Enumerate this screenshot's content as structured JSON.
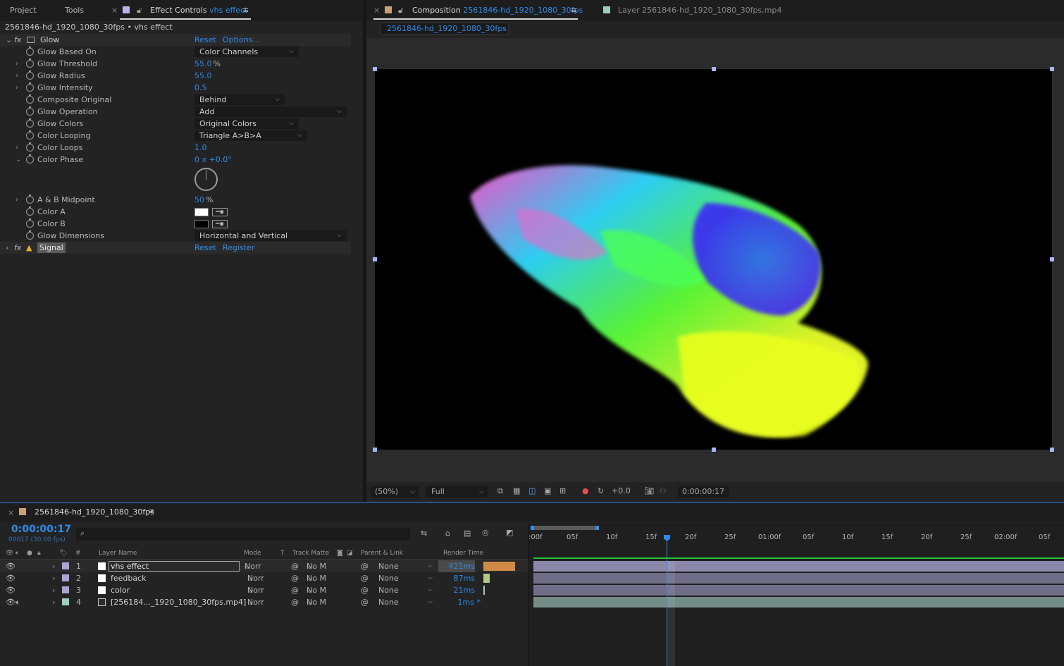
{
  "left_panel": {
    "tabs": [
      "Project",
      "Tools"
    ],
    "effect_controls_tab": {
      "label": "Effect Controls",
      "layer": "vhs effect"
    },
    "breadcrumb": "2561846-hd_1920_1080_30fps • vhs effect",
    "glow": {
      "name": "Glow",
      "reset": "Reset",
      "options": "Options...",
      "params": [
        {
          "name": "Glow Based On",
          "type": "dropdown",
          "value": "Color Channels"
        },
        {
          "name": "Glow Threshold",
          "type": "value",
          "value": "55.0",
          "unit": "%"
        },
        {
          "name": "Glow Radius",
          "type": "value",
          "value": "55.0"
        },
        {
          "name": "Glow Intensity",
          "type": "value",
          "value": "0.5"
        },
        {
          "name": "Composite Original",
          "type": "dropdown",
          "value": "Behind"
        },
        {
          "name": "Glow Operation",
          "type": "dropdown",
          "value": "Add"
        },
        {
          "name": "Glow Colors",
          "type": "dropdown",
          "value": "Original Colors"
        },
        {
          "name": "Color Looping",
          "type": "dropdown",
          "value": "Triangle A>B>A"
        },
        {
          "name": "Color Loops",
          "type": "value",
          "value": "1.0"
        },
        {
          "name": "Color Phase",
          "type": "value",
          "value": "0 x +0.0",
          "unit": "°"
        },
        {
          "name": "A & B Midpoint",
          "type": "value",
          "value": "50",
          "unit": "%"
        },
        {
          "name": "Color A",
          "type": "color",
          "value": "#ffffff"
        },
        {
          "name": "Color B",
          "type": "color",
          "value": "#000000"
        },
        {
          "name": "Glow Dimensions",
          "type": "dropdown",
          "value": "Horizontal and Vertical"
        }
      ]
    },
    "signal": {
      "name": "Signal",
      "reset": "Reset",
      "register": "Register"
    }
  },
  "comp_panel": {
    "tab_label": "Composition",
    "comp_name": "2561846-hd_1920_1080_30fps",
    "layer_tab": "Layer  2561846-hd_1920_1080_30fps.mp4",
    "subtab": "2561846-hd_1920_1080_30fps",
    "zoom": "(50%)",
    "resolution": "Full",
    "exposure": "+0.0",
    "timecode": "0:00:00:17"
  },
  "timeline": {
    "tab_label": "2561846-hd_1920_1080_30fps",
    "current_time": "0:00:00:17",
    "frame_info": "00017 (30.00 fps)",
    "search_placeholder": "",
    "columns": {
      "hash": "#",
      "layer_name": "Layer Name",
      "mode": "Mode",
      "t": "T",
      "track_matte": "Track Matte",
      "parent_link": "Parent & Link",
      "render_time": "Render Time"
    },
    "layers": [
      {
        "num": "1",
        "name": "vhs effect",
        "mode": "Norr",
        "matte": "No M",
        "parent": "None",
        "render": "421ms",
        "render_frac": 0.95,
        "label_color": "#a9a4d8",
        "selected": true
      },
      {
        "num": "2",
        "name": "feedback",
        "mode": "Norr",
        "matte": "No M",
        "parent": "None",
        "render": "87ms",
        "render_frac": 0.2,
        "label_color": "#a9a4d8",
        "selected": false
      },
      {
        "num": "3",
        "name": "color",
        "mode": "Norr",
        "matte": "No M",
        "parent": "None",
        "render": "21ms",
        "render_frac": 0.05,
        "label_color": "#a9a4d8",
        "selected": false
      },
      {
        "num": "4",
        "name": "[256184..._1920_1080_30fps.mp4]",
        "mode": "Norr",
        "matte": "No M",
        "parent": "None",
        "render": "1ms *",
        "render_frac": 0.01,
        "label_color": "#9ecdc3",
        "selected": false
      }
    ],
    "ruler": [
      ":00f",
      "05f",
      "10f",
      "15f",
      "20f",
      "25f",
      "01:00f",
      "05f",
      "10f",
      "15f",
      "20f",
      "25f",
      "02:00f",
      "05f"
    ]
  }
}
